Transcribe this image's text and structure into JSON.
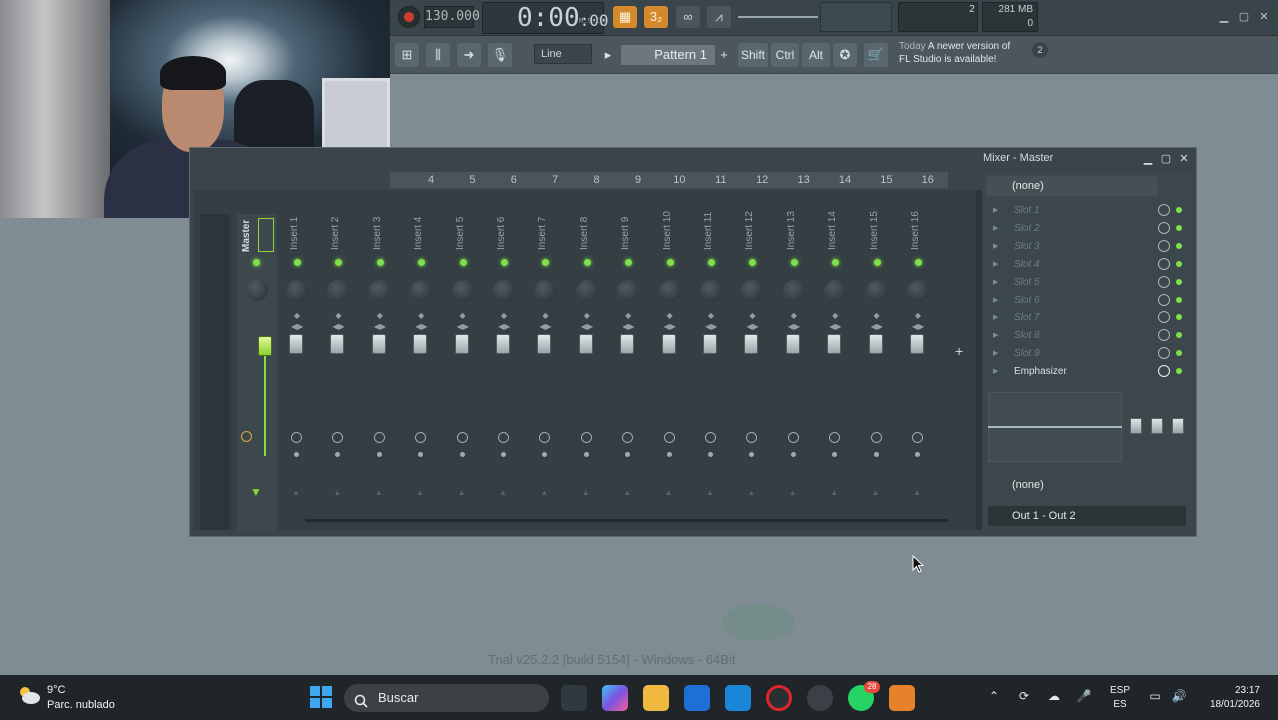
{
  "toolbar": {
    "tempo": "130.000",
    "time": "0:00",
    "time_frac": ":00",
    "time_unit": "M:S:CS",
    "cpu_value": "2",
    "voices": "0",
    "memory": "281 MB",
    "snap_mode": "Line",
    "pattern": "Pattern 1",
    "shift_label": "Shift",
    "ctrl_label": "Ctrl",
    "alt_label": "Alt",
    "news_prefix": "Today",
    "news_text": "A newer version of FL Studio is available!",
    "news_count": "2"
  },
  "mixer": {
    "title": "Mixer - Master",
    "track_numbers": [
      "4",
      "5",
      "6",
      "7",
      "8",
      "9",
      "10",
      "11",
      "12",
      "13",
      "14",
      "15",
      "16"
    ],
    "master_name": "Master",
    "channels": [
      "Insert 1",
      "Insert 2",
      "Insert 3",
      "Insert 4",
      "Insert 5",
      "Insert 6",
      "Insert 7",
      "Insert 8",
      "Insert 9",
      "Insert 10",
      "Insert 11",
      "Insert 12",
      "Insert 13",
      "Insert 14",
      "Insert 15",
      "Insert 16"
    ],
    "preset": "(none)",
    "slots": [
      "Slot 1",
      "Slot 2",
      "Slot 3",
      "Slot 4",
      "Slot 5",
      "Slot 6",
      "Slot 7",
      "Slot 8",
      "Slot 9"
    ],
    "active_effect": "Emphasizer",
    "input_route": "(none)",
    "output_route": "Out 1 - Out 2"
  },
  "desktop": {
    "watermark": "Trial v25.2.2 [build 5154] - Windows - 64Bit"
  },
  "taskbar": {
    "temperature": "9°C",
    "weather": "Parc. nublado",
    "search_placeholder": "Buscar",
    "whatsapp_badge": "28",
    "lang_top": "ESP",
    "lang_bottom": "ES",
    "time": "23:17",
    "date": "18/01/2026"
  },
  "colors": {
    "fl_accent": "#d48a2b",
    "led_green": "#7fe04a",
    "taskbar_bg": "#1f2528"
  }
}
